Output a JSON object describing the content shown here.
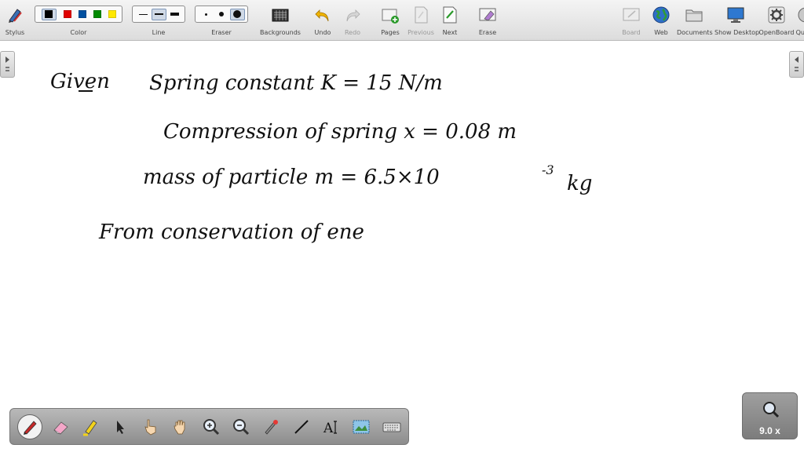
{
  "toolbar": {
    "stylus": "Stylus",
    "color": "Color",
    "line": "Line",
    "eraser": "Eraser",
    "backgrounds": "Backgrounds",
    "undo": "Undo",
    "redo": "Redo",
    "pages": "Pages",
    "previous": "Previous",
    "next": "Next",
    "erase": "Erase",
    "board": "Board",
    "web": "Web",
    "documents": "Documents",
    "show_desktop": "Show Desktop",
    "openboard": "OpenBoard",
    "quit": "Quit"
  },
  "colors": [
    "#000000",
    "#e00000",
    "#0050a0",
    "#008a00",
    "#ffe800"
  ],
  "handwriting": {
    "given": "Given",
    "spring_constant": "Spring constant  K = 15 N/m",
    "compression": "Compression of spring  x =  0.08 m",
    "mass": "mass   of   particle      m =   6.5×10",
    "mass_exp": "-3",
    "mass_unit": "kg",
    "conservation": "From  conservation   of   ene"
  },
  "bottom_tools": [
    "pen-tool",
    "eraser-tool",
    "marker-tool",
    "selector-tool",
    "interact-tool",
    "hand-tool",
    "zoom-in-tool",
    "zoom-out-tool",
    "laser-pointer-tool",
    "line-tool",
    "text-tool",
    "capture-tool",
    "keyboard-tool"
  ],
  "zoom": {
    "value": "9.0 x"
  }
}
